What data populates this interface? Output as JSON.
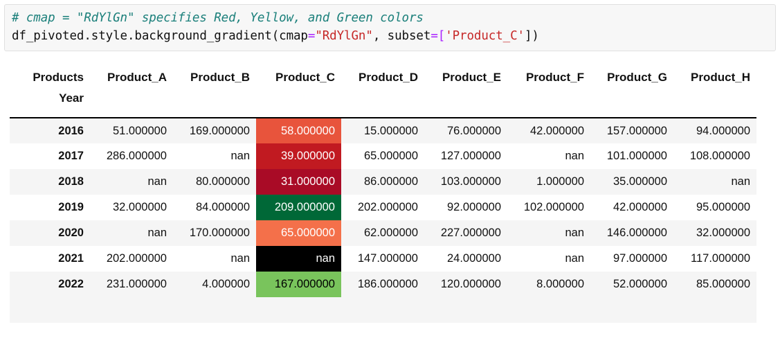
{
  "code": {
    "lines": [
      [
        {
          "t": "comment",
          "s": "# cmap = \"RdYlGn\" specifies Red, Yellow, and Green colors"
        }
      ],
      [
        {
          "t": "plain",
          "s": "df_pivoted.style.background_gradient(cmap"
        },
        {
          "t": "op",
          "s": "="
        },
        {
          "t": "str",
          "s": "\"RdYlGn\""
        },
        {
          "t": "plain",
          "s": ", subset"
        },
        {
          "t": "op",
          "s": "=["
        },
        {
          "t": "str",
          "s": "'Product_C'"
        },
        {
          "t": "plain",
          "s": "])"
        }
      ]
    ]
  },
  "table": {
    "columns_axis_name": "Products",
    "index_axis_name": "Year",
    "columns": [
      "Product_A",
      "Product_B",
      "Product_C",
      "Product_D",
      "Product_E",
      "Product_F",
      "Product_G",
      "Product_H"
    ],
    "gradient_column": "Product_C",
    "gradient_column_index": 2,
    "rows": [
      {
        "index": "2016",
        "cells": [
          "51.000000",
          "169.000000",
          "58.000000",
          "15.000000",
          "76.000000",
          "42.000000",
          "157.000000",
          "94.000000"
        ],
        "grad_color": "#e8543c",
        "grad_text": "#ffffff"
      },
      {
        "index": "2017",
        "cells": [
          "286.000000",
          "nan",
          "39.000000",
          "65.000000",
          "127.000000",
          "nan",
          "101.000000",
          "108.000000"
        ],
        "grad_color": "#c11a21",
        "grad_text": "#ffffff"
      },
      {
        "index": "2018",
        "cells": [
          "nan",
          "80.000000",
          "31.000000",
          "86.000000",
          "103.000000",
          "1.000000",
          "35.000000",
          "nan"
        ],
        "grad_color": "#a90b26",
        "grad_text": "#ffffff"
      },
      {
        "index": "2019",
        "cells": [
          "32.000000",
          "84.000000",
          "209.000000",
          "202.000000",
          "92.000000",
          "102.000000",
          "42.000000",
          "95.000000"
        ],
        "grad_color": "#006837",
        "grad_text": "#ffffff"
      },
      {
        "index": "2020",
        "cells": [
          "nan",
          "170.000000",
          "65.000000",
          "62.000000",
          "227.000000",
          "nan",
          "146.000000",
          "32.000000"
        ],
        "grad_color": "#f4704a",
        "grad_text": "#ffffff"
      },
      {
        "index": "2021",
        "cells": [
          "202.000000",
          "nan",
          "nan",
          "147.000000",
          "24.000000",
          "nan",
          "97.000000",
          "117.000000"
        ],
        "grad_color": "#000000",
        "grad_text": "#ffffff"
      },
      {
        "index": "2022",
        "cells": [
          "231.000000",
          "4.000000",
          "167.000000",
          "186.000000",
          "120.000000",
          "8.000000",
          "52.000000",
          "85.000000"
        ],
        "grad_color": "#79c45c",
        "grad_text": "#000000"
      }
    ]
  },
  "colors": {
    "comment": "#1a7f7a",
    "string": "#c62828",
    "operator": "#aa22ff",
    "code_bg": "#f7f7f7",
    "stripe": "#f5f5f5"
  }
}
